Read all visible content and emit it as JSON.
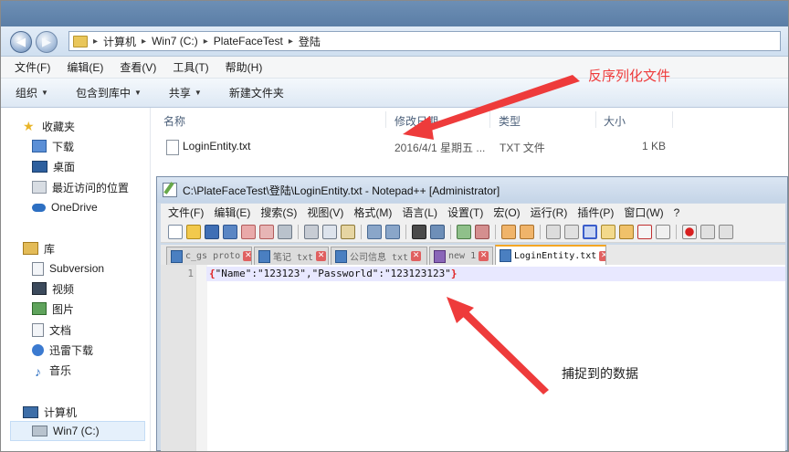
{
  "explorer": {
    "nav_back": "◀",
    "nav_forward": "▶",
    "breadcrumbs": [
      "计算机",
      "Win7 (C:)",
      "PlateFaceTest",
      "登陆"
    ],
    "menu": [
      "文件(F)",
      "编辑(E)",
      "查看(V)",
      "工具(T)",
      "帮助(H)"
    ],
    "toolbar": [
      "组织",
      "包含到库中",
      "共享",
      "新建文件夹"
    ],
    "sidebar": {
      "favorites_label": "收藏夹",
      "favorites": [
        "下载",
        "桌面",
        "最近访问的位置",
        "OneDrive"
      ],
      "libraries_label": "库",
      "libraries": [
        "Subversion",
        "视频",
        "图片",
        "文档",
        "迅雷下载",
        "音乐"
      ],
      "computer_label": "计算机",
      "drive": "Win7 (C:)"
    },
    "columns": [
      "名称",
      "修改日期",
      "类型",
      "大小"
    ],
    "file": {
      "name": "LoginEntity.txt",
      "date": "2016/4/1 星期五 ...",
      "type": "TXT 文件",
      "size": "1 KB"
    }
  },
  "notepad": {
    "title": "C:\\PlateFaceTest\\登陆\\LoginEntity.txt - Notepad++ [Administrator]",
    "menu": [
      "文件(F)",
      "编辑(E)",
      "搜索(S)",
      "视图(V)",
      "格式(M)",
      "语言(L)",
      "设置(T)",
      "宏(O)",
      "运行(R)",
      "插件(P)",
      "窗口(W)",
      "?"
    ],
    "tabs": [
      "c_gs proto",
      "笔记 txt",
      "公司信息 txt",
      "new 1",
      "LoginEntity.txt"
    ],
    "active_tab_index": 4,
    "line_number": "1",
    "brace_open": "{",
    "code": "\"Name\":\"123123\",\"Passworld\":\"123123123\"",
    "brace_close": "}"
  },
  "annotations": {
    "top": "反序列化文件",
    "bottom": "捕捉到的数据",
    "color": "#ee3b3b"
  }
}
